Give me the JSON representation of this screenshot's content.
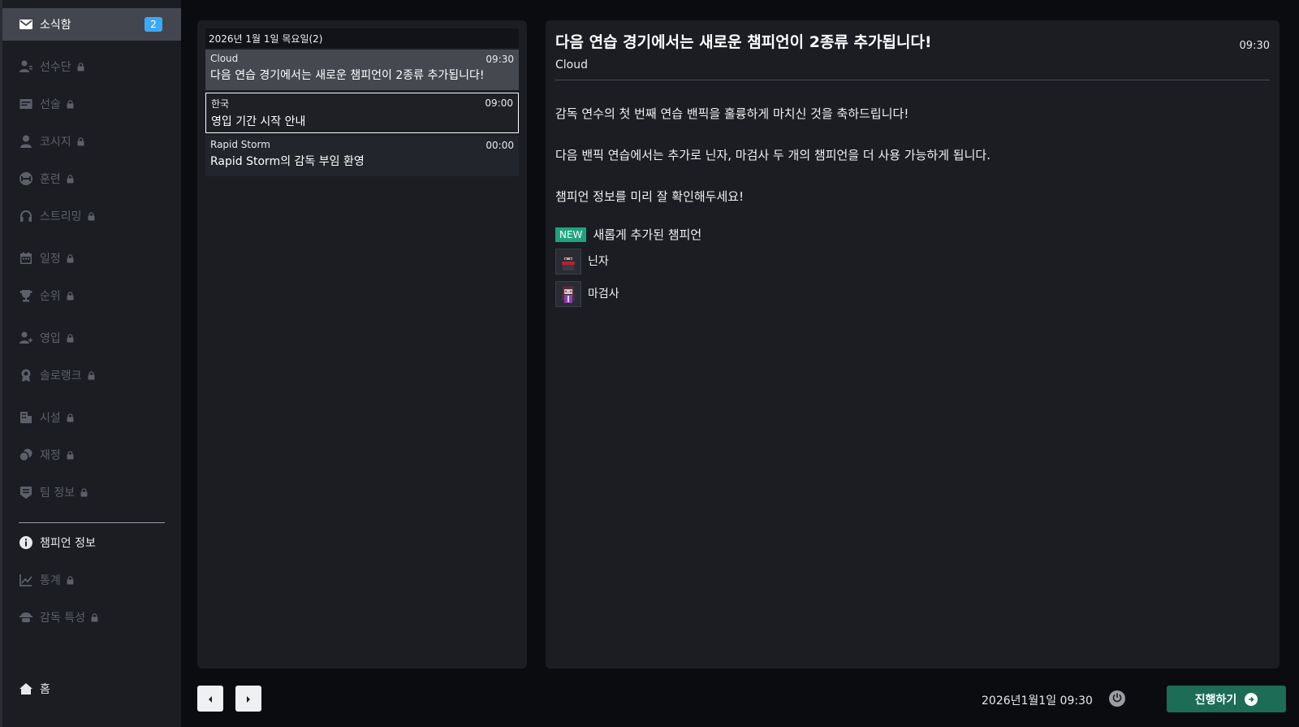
{
  "sidebar": {
    "items": [
      {
        "label": "소식함",
        "icon": "mail-icon",
        "locked": false,
        "badge": "2"
      },
      {
        "label": "선수단",
        "icon": "players-icon",
        "locked": true
      },
      {
        "label": "선술",
        "icon": "tactics-icon",
        "locked": true
      },
      {
        "label": "코시지",
        "icon": "coach-icon",
        "locked": true
      },
      {
        "label": "훈련",
        "icon": "training-icon",
        "locked": true
      },
      {
        "label": "스트리밍",
        "icon": "headset-icon",
        "locked": true
      },
      {
        "label": "일정",
        "icon": "calendar-icon",
        "locked": true
      },
      {
        "label": "순위",
        "icon": "trophy-icon",
        "locked": true
      },
      {
        "label": "영입",
        "icon": "recruit-icon",
        "locked": true
      },
      {
        "label": "솔로랭크",
        "icon": "medal-icon",
        "locked": true
      },
      {
        "label": "시설",
        "icon": "building-icon",
        "locked": true
      },
      {
        "label": "재정",
        "icon": "coins-icon",
        "locked": true
      },
      {
        "label": "팀 정보",
        "icon": "team-info-icon",
        "locked": true
      },
      {
        "label": "챔피언 정보",
        "icon": "info-icon",
        "locked": false
      },
      {
        "label": "통계",
        "icon": "chart-icon",
        "locked": true
      },
      {
        "label": "감독 특성",
        "icon": "manager-icon",
        "locked": true
      },
      {
        "label": "홈",
        "icon": "home-icon",
        "locked": false
      }
    ]
  },
  "inbox": {
    "date_header": "2026년 1월 1일 목요일(2)",
    "messages": [
      {
        "sender": "Cloud",
        "time": "09:30",
        "subject": "다음 연습 경기에서는 새로운 챔피언이 2종류 추가됩니다!"
      },
      {
        "sender": "한국",
        "time": "09:00",
        "subject": "영입 기간 시작 안내"
      },
      {
        "sender": "Rapid Storm",
        "time": "00:00",
        "subject": "Rapid Storm의 감독 부임 환영"
      }
    ]
  },
  "detail": {
    "title": "다음 연습 경기에서는 새로운 챔피언이 2종류 추가됩니다!",
    "time": "09:30",
    "sender": "Cloud",
    "body": [
      "감독 연수의 첫 번째 연습 밴픽을 훌륭하게 마치신 것을 축하드립니다!",
      "다음 밴픽 연습에서는 추가로 닌자, 마검사 두 개의 챔피언을 더 사용 가능하게 됩니다.",
      "챔피언 정보를 미리 잘 확인해두세요!"
    ],
    "new_badge": "NEW",
    "new_section_title": "새롭게 추가된 챔피언",
    "champions": [
      {
        "name": "닌자"
      },
      {
        "name": "마검사"
      }
    ]
  },
  "footer": {
    "datetime": "2026년1월1일 09:30",
    "proceed_label": "진행하기"
  },
  "colors": {
    "accent_new": "#1fa37e",
    "badge_blue": "#3da9f5",
    "proceed_green": "#1d6c55"
  }
}
